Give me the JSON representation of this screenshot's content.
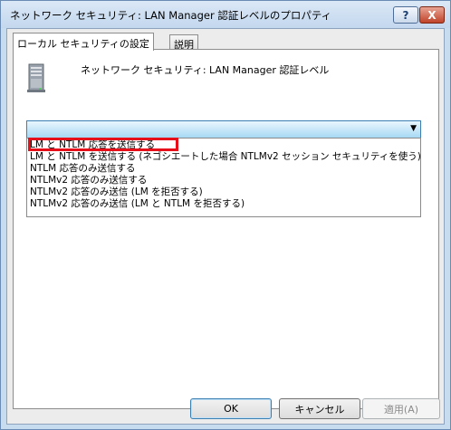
{
  "window": {
    "title": "ネットワーク セキュリティ: LAN Manager 認証レベルのプロパティ",
    "help_label": "?",
    "close_label": "X"
  },
  "tabs": [
    {
      "label": "ローカル セキュリティの設定",
      "active": true
    },
    {
      "label": "説明",
      "active": false
    }
  ],
  "policy": {
    "title": "ネットワーク セキュリティ: LAN Manager 認証レベル",
    "icon": "server-icon"
  },
  "combo": {
    "selected": "",
    "arrow_icon": "chevron-down-icon"
  },
  "options": [
    {
      "label": "LM と NTLM 応答を送信する",
      "highlighted": true
    },
    {
      "label": "LM と NTLM を送信する (ネゴシエートした場合 NTLMv2 セッション セキュリティを使う)",
      "highlighted": false
    },
    {
      "label": "NTLM 応答のみ送信する",
      "highlighted": false
    },
    {
      "label": "NTLMv2 応答のみ送信する",
      "highlighted": false
    },
    {
      "label": "NTLMv2 応答のみ送信 (LM を拒否する)",
      "highlighted": false
    },
    {
      "label": "NTLMv2 応答のみ送信 (LM と NTLM を拒否する)",
      "highlighted": false
    }
  ],
  "buttons": {
    "ok": "OK",
    "cancel": "キャンセル",
    "apply": "適用(A)"
  },
  "colors": {
    "highlight_box": "#e6101a",
    "combo_border": "#3c7fb1"
  }
}
